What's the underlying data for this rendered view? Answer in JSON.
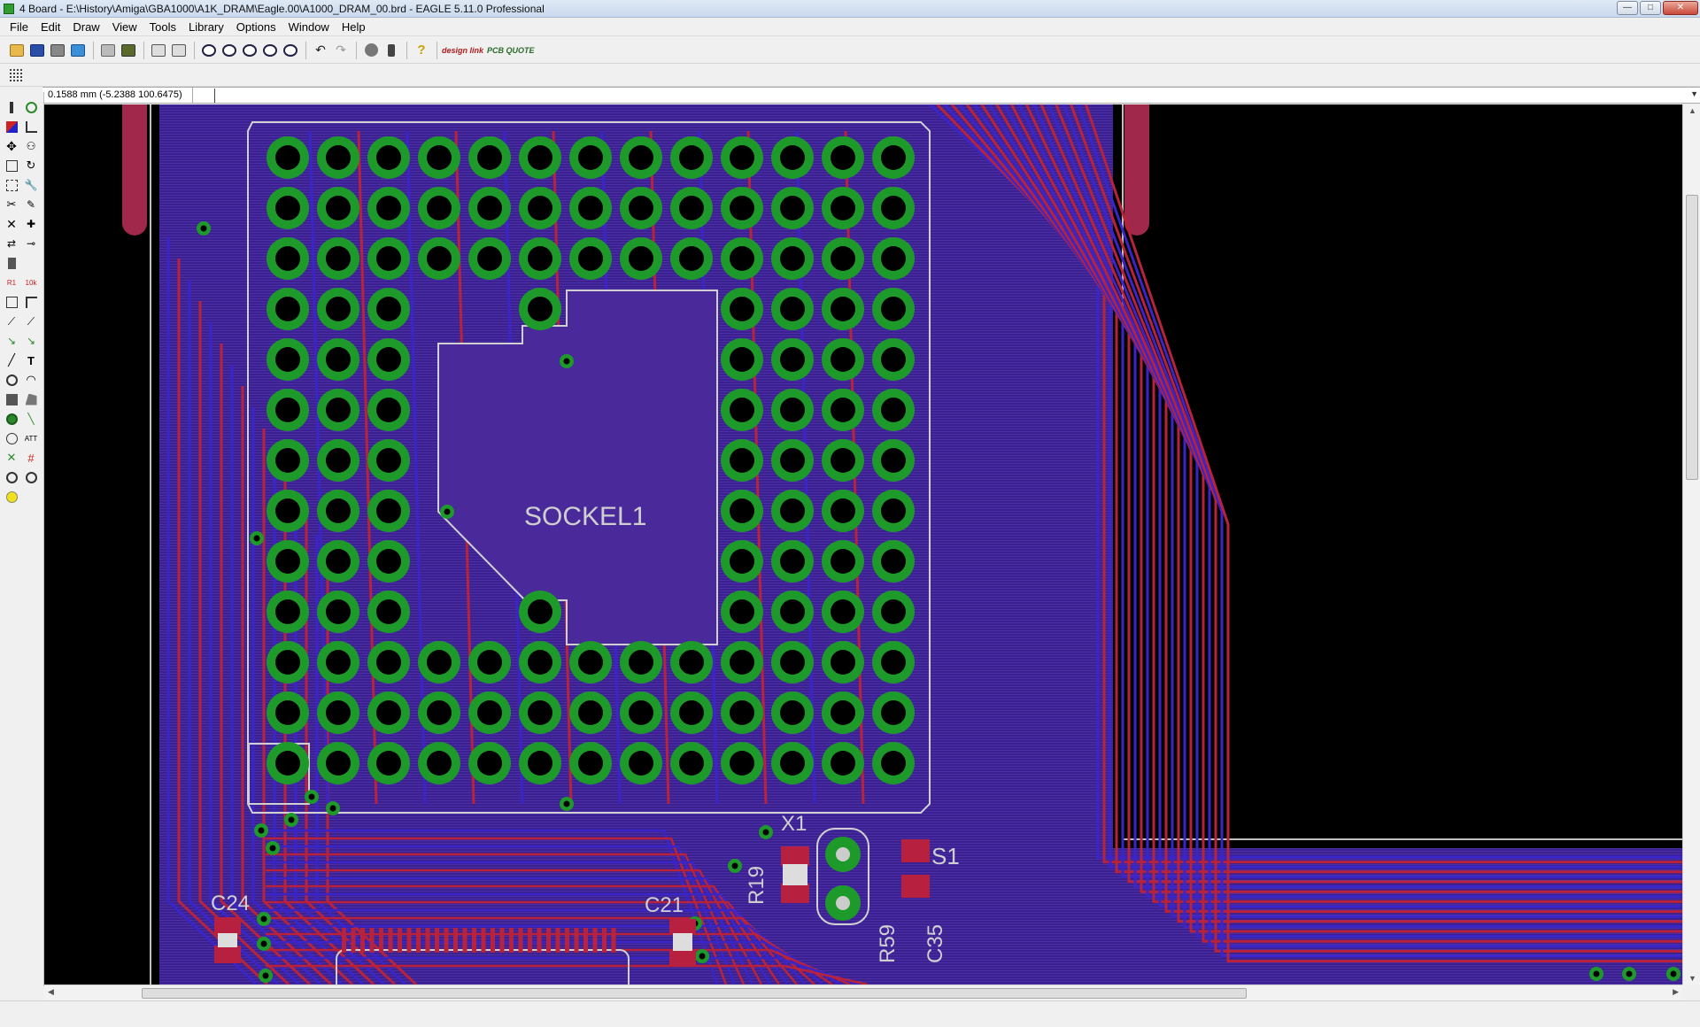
{
  "window": {
    "title": "4 Board - E:\\History\\Amiga\\GBA1000\\A1K_DRAM\\Eagle.00\\A1000_DRAM_00.brd - EAGLE 5.11.0 Professional",
    "minimize": "—",
    "maximize": "□",
    "close": "✕"
  },
  "menu": [
    "File",
    "Edit",
    "Draw",
    "View",
    "Tools",
    "Library",
    "Options",
    "Window",
    "Help"
  ],
  "toolbar": {
    "designlink_label": "design link",
    "pcbquote_label": "PCB QUOTE",
    "help_glyph": "?"
  },
  "command": {
    "coords": "0.1588 mm (-5.2388 100.6475)",
    "value": ""
  },
  "board": {
    "package_label": "SOCKEL1",
    "labels": {
      "x1": "X1",
      "s1": "S1",
      "r19": "R19",
      "r59": "R59",
      "c35": "C35",
      "c24": "C24",
      "c21": "C21"
    }
  },
  "colors": {
    "background": "#000000",
    "copper_top": "#b8233b",
    "copper_bottom": "#3a25c8",
    "polygon_fill": "#4a2a9a",
    "pad": "#1d9a2a",
    "silkscreen": "#cfcfcf"
  }
}
